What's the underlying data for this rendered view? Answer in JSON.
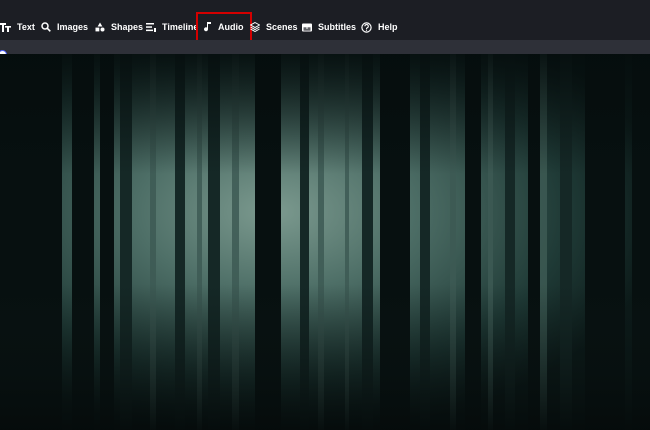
{
  "toolbar": {
    "items": [
      {
        "label": "Text",
        "icon": "text-icon"
      },
      {
        "label": "Images",
        "icon": "search-icon"
      },
      {
        "label": "Shapes",
        "icon": "shapes-icon"
      },
      {
        "label": "Timeline",
        "icon": "timeline-icon"
      },
      {
        "label": "Audio",
        "icon": "music-note-icon",
        "active": true
      },
      {
        "label": "Scenes",
        "icon": "layers-icon"
      },
      {
        "label": "Subtitles",
        "icon": "subtitles-icon"
      },
      {
        "label": "Help",
        "icon": "help-icon"
      }
    ],
    "active_outline_color": "#d40000"
  },
  "preview": {
    "scene": "dark forest video frame"
  }
}
